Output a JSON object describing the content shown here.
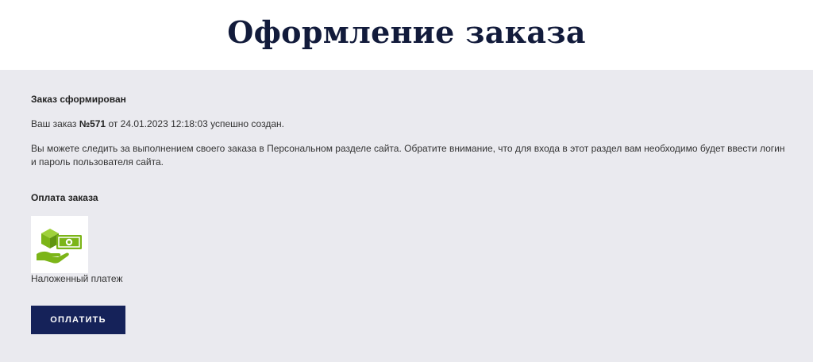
{
  "header": {
    "title": "Оформление заказа"
  },
  "order": {
    "section_title": "Заказ сформирован",
    "text_before": "Ваш заказ ",
    "number": "№571",
    "text_after": " от 24.01.2023 12:18:03 успешно создан.",
    "info": "Вы можете следить за выполнением своего заказа в Персональном разделе сайта. Обратите внимание, что для входа в этот раздел вам необходимо будет ввести логин и пароль пользователя сайта."
  },
  "payment": {
    "section_title": "Оплата заказа",
    "method_icon": "cash-on-delivery-icon",
    "method_name": "Наложенный платеж",
    "pay_button_label": "ОПЛАТИТЬ",
    "icon_color": "#7cb518"
  },
  "colors": {
    "title": "#121b3b",
    "background": "#eaeaef",
    "button": "#152259"
  }
}
